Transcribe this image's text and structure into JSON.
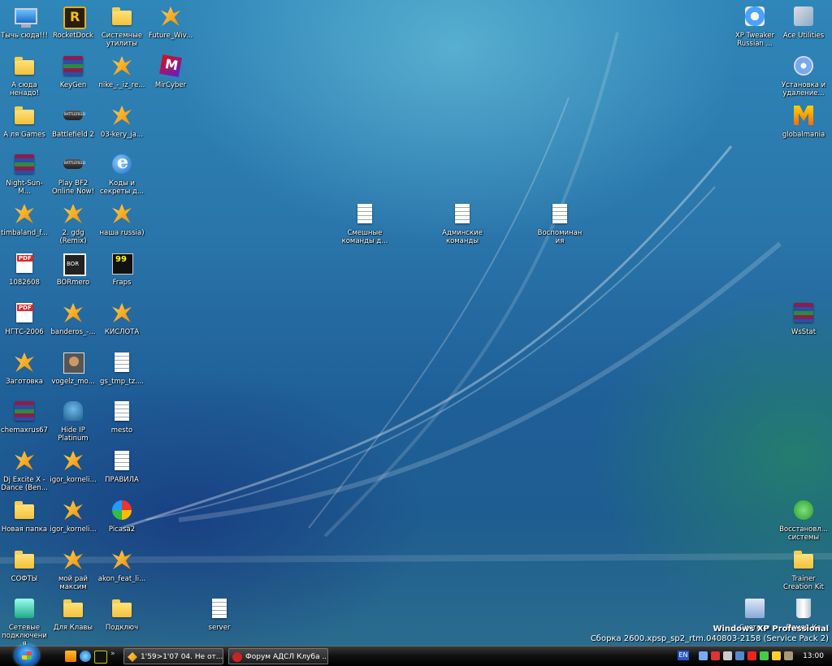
{
  "desktop_icons": [
    {
      "label": "Тычь сюда!!!",
      "icon": "computer-icon"
    },
    {
      "label": "RocketDock",
      "icon": "rocketdock-icon"
    },
    {
      "label": "Системные утилиты",
      "icon": "folder-icon"
    },
    {
      "label": "Future_Wiv...",
      "icon": "winamp-file-icon"
    },
    {
      "label": "А сюда ненадо!",
      "icon": "folder-icon"
    },
    {
      "label": "KeyGen",
      "icon": "winrar-icon"
    },
    {
      "label": "nike_-_iz_re...",
      "icon": "winamp-file-icon"
    },
    {
      "label": "MirCyber",
      "icon": "mircyber-icon"
    },
    {
      "label": "А ля Games",
      "icon": "folder-icon"
    },
    {
      "label": "Battlefield 2",
      "icon": "battlefield-icon"
    },
    {
      "label": "03-kery_ja...",
      "icon": "winamp-file-icon"
    },
    {
      "label": "Night-Sun-M...",
      "icon": "winrar-icon"
    },
    {
      "label": "Play BF2 Online Now!",
      "icon": "battlefield-icon"
    },
    {
      "label": "Коды и секреты д...",
      "icon": "internet-explorer-icon"
    },
    {
      "label": "timbaland_f...",
      "icon": "winamp-file-icon"
    },
    {
      "label": "2. gdg (Remix)",
      "icon": "winamp-file-icon"
    },
    {
      "label": "наша russia)",
      "icon": "winamp-file-icon"
    },
    {
      "label": "Смешные команды д...",
      "icon": "text-file-icon"
    },
    {
      "label": "Админские команды",
      "icon": "text-file-icon"
    },
    {
      "label": "Воспоминания",
      "icon": "text-file-icon"
    },
    {
      "label": "1082608",
      "icon": "pdf-icon"
    },
    {
      "label": "BORmero",
      "icon": "video-file-icon"
    },
    {
      "label": "Fraps",
      "icon": "fraps-icon"
    },
    {
      "label": "НГТС-2006",
      "icon": "pdf-icon"
    },
    {
      "label": "banderos_-...",
      "icon": "winamp-file-icon"
    },
    {
      "label": "КИСЛОТА",
      "icon": "winamp-file-icon"
    },
    {
      "label": "Заготовка",
      "icon": "winamp-file-icon"
    },
    {
      "label": "vogelz_mo...",
      "icon": "image-file-icon"
    },
    {
      "label": "gs_tmp_tz....",
      "icon": "text-file-icon"
    },
    {
      "label": "chemaxrus67",
      "icon": "winrar-icon"
    },
    {
      "label": "Hide IP Platinum",
      "icon": "hide-ip-icon"
    },
    {
      "label": "mesto",
      "icon": "text-file-icon"
    },
    {
      "label": "Dj Excite X - Dance (Ben...",
      "icon": "winamp-file-icon"
    },
    {
      "label": "igor_korneli...",
      "icon": "winamp-file-icon"
    },
    {
      "label": "ПРАВИЛА",
      "icon": "text-file-icon"
    },
    {
      "label": "Новая папка",
      "icon": "folder-icon"
    },
    {
      "label": "igor_korneli...",
      "icon": "winamp-file-icon"
    },
    {
      "label": "Picasa2",
      "icon": "picasa-icon"
    },
    {
      "label": "СОФТЫ",
      "icon": "folder-icon"
    },
    {
      "label": "мой рай максим",
      "icon": "winamp-file-icon"
    },
    {
      "label": "akon_feat_li...",
      "icon": "winamp-file-icon"
    },
    {
      "label": "Сетевые подключения",
      "icon": "network-icon"
    },
    {
      "label": "Для Клавы",
      "icon": "folder-icon"
    },
    {
      "label": "Подключ",
      "icon": "folder-icon"
    },
    {
      "label": "server",
      "icon": "text-file-icon"
    },
    {
      "label": "XP Tweaker Russian ...",
      "icon": "xp-tweaker-icon"
    },
    {
      "label": "Ace Utilities",
      "icon": "ace-utilities-icon"
    },
    {
      "label": "Установка и удаление...",
      "icon": "add-remove-programs-icon"
    },
    {
      "label": "globalmania",
      "icon": "globalmania-icon"
    },
    {
      "label": "WsStat",
      "icon": "winrar-icon"
    },
    {
      "label": "Восстановл... системы",
      "icon": "system-restore-icon"
    },
    {
      "label": "Trainer Creation Kit",
      "icon": "folder-icon"
    },
    {
      "label": "Система",
      "icon": "system-icon"
    },
    {
      "label": "Помой-Ка",
      "icon": "recycle-bin-icon"
    }
  ],
  "branding": {
    "os_name": "Windows XP Professional",
    "build": "Сборка 2600.xpsp_sp2_rtm.040803-2158 (Service Pack 2)"
  },
  "taskbar": {
    "quick_launch": [
      "media-player-icon",
      "internet-explorer-icon",
      "fraps-icon"
    ],
    "more": "»",
    "buttons": [
      {
        "label": "1'59>1'07 04. Не от...",
        "icon": "winamp-icon"
      },
      {
        "label": "Форум АДСЛ Клуба ...",
        "icon": "opera-icon"
      }
    ],
    "lang": "EN",
    "clock": "13:00"
  }
}
